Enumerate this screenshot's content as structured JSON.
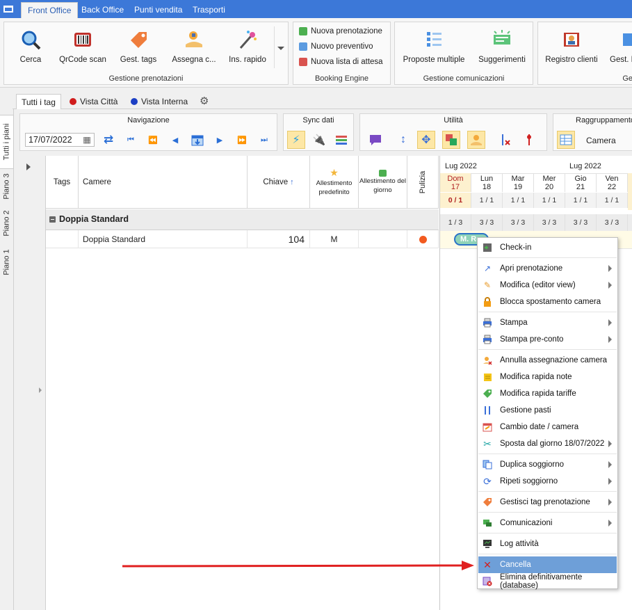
{
  "menu_tabs": [
    "Front Office",
    "Back Office",
    "Punti vendita",
    "Trasporti"
  ],
  "ribbon": {
    "prenotazioni": {
      "label": "Gestione prenotazioni",
      "buttons": [
        "Cerca",
        "QrCode scan",
        "Gest. tags",
        "Assegna c...",
        "Ins. rapido"
      ]
    },
    "booking": {
      "label": "Booking Engine",
      "items": [
        "Nuova prenotazione",
        "Nuovo preventivo",
        "Nuova lista di attesa"
      ]
    },
    "comunicazioni": {
      "label": "Gestione comunicazioni",
      "buttons": [
        "Proposte multiple",
        "Suggerimenti"
      ]
    },
    "clienti": {
      "label": "Ge",
      "buttons": [
        "Registro clienti",
        "Gest. D"
      ]
    }
  },
  "tag_tabs": [
    "Tutti i tag",
    "Vista Città",
    "Vista Interna"
  ],
  "vertical_tabs": [
    "Tutti i piani",
    "Piano 3",
    "Piano 2",
    "Piano 1"
  ],
  "toolbar": {
    "navigazione": {
      "label": "Navigazione",
      "date": "17/07/2022"
    },
    "sync": {
      "label": "Sync dati"
    },
    "utilita": {
      "label": "Utilità"
    },
    "raggruppamento": {
      "label": "Raggruppamento",
      "value": "Camera"
    }
  },
  "grid": {
    "headers": {
      "tags": "Tags",
      "camere": "Camere",
      "chiave": "Chiave",
      "allestimento_predefinito": "Allestimento predefinito",
      "allestimento_giorno": "Allestimento del giorno",
      "pulizia": "Pulizia"
    },
    "group": "Doppia Standard",
    "row": {
      "camera": "Doppia Standard",
      "chiave": "104",
      "allestimento": "M"
    }
  },
  "calendar": {
    "month_left": "Lug 2022",
    "month_right": "Lug 2022",
    "days": [
      {
        "name": "Dom",
        "num": "17",
        "occ": "0 / 1",
        "avail": "1 / 3"
      },
      {
        "name": "Lun",
        "num": "18",
        "occ": "1 / 1",
        "avail": "3 / 3"
      },
      {
        "name": "Mar",
        "num": "19",
        "occ": "1 / 1",
        "avail": "3 / 3"
      },
      {
        "name": "Mer",
        "num": "20",
        "occ": "1 / 1",
        "avail": "3 / 3"
      },
      {
        "name": "Gio",
        "num": "21",
        "occ": "1 / 1",
        "avail": "3 / 3"
      },
      {
        "name": "Ven",
        "num": "22",
        "occ": "1 / 1",
        "avail": "3 / 3"
      }
    ],
    "booking_label": "M. Ro"
  },
  "context_menu": [
    {
      "label": "Check-in",
      "icon": "checkin-icon",
      "sub": false
    },
    {
      "label": "Apri prenotazione",
      "icon": "open-icon",
      "sub": true
    },
    {
      "label": "Modifica (editor view)",
      "icon": "pencil-icon",
      "sub": true
    },
    {
      "label": "Blocca spostamento camera",
      "icon": "lock-icon",
      "sub": false
    },
    {
      "label": "Stampa",
      "icon": "printer-icon",
      "sub": true
    },
    {
      "label": "Stampa pre-conto",
      "icon": "printer-icon",
      "sub": true
    },
    {
      "label": "Annulla assegnazione camera",
      "icon": "unassign-icon",
      "sub": false
    },
    {
      "label": "Modifica rapida note",
      "icon": "note-icon",
      "sub": false
    },
    {
      "label": "Modifica rapida tariffe",
      "icon": "tag-icon",
      "sub": false
    },
    {
      "label": "Gestione pasti",
      "icon": "cutlery-icon",
      "sub": false
    },
    {
      "label": "Cambio date / camera",
      "icon": "calendar-icon",
      "sub": false
    },
    {
      "label": "Sposta dal giorno 18/07/2022",
      "icon": "scissors-icon",
      "sub": true
    },
    {
      "label": "Duplica soggiorno",
      "icon": "duplicate-icon",
      "sub": true
    },
    {
      "label": "Ripeti soggiorno",
      "icon": "repeat-icon",
      "sub": true
    },
    {
      "label": "Gestisci tag prenotazione",
      "icon": "tag-icon",
      "sub": true
    },
    {
      "label": "Comunicazioni",
      "icon": "chat-icon",
      "sub": true
    },
    {
      "label": "Log attività",
      "icon": "monitor-icon",
      "sub": false
    },
    {
      "label": "Cancella",
      "icon": "x-icon",
      "sub": false
    },
    {
      "label": "Elimina definitivamente (database)",
      "icon": "delete-db-icon",
      "sub": false
    }
  ],
  "colors": {
    "accent": "#3c78d8",
    "highlight": "#fde7a6",
    "selected": "#6e9fd8",
    "arrow": "#e02020"
  }
}
